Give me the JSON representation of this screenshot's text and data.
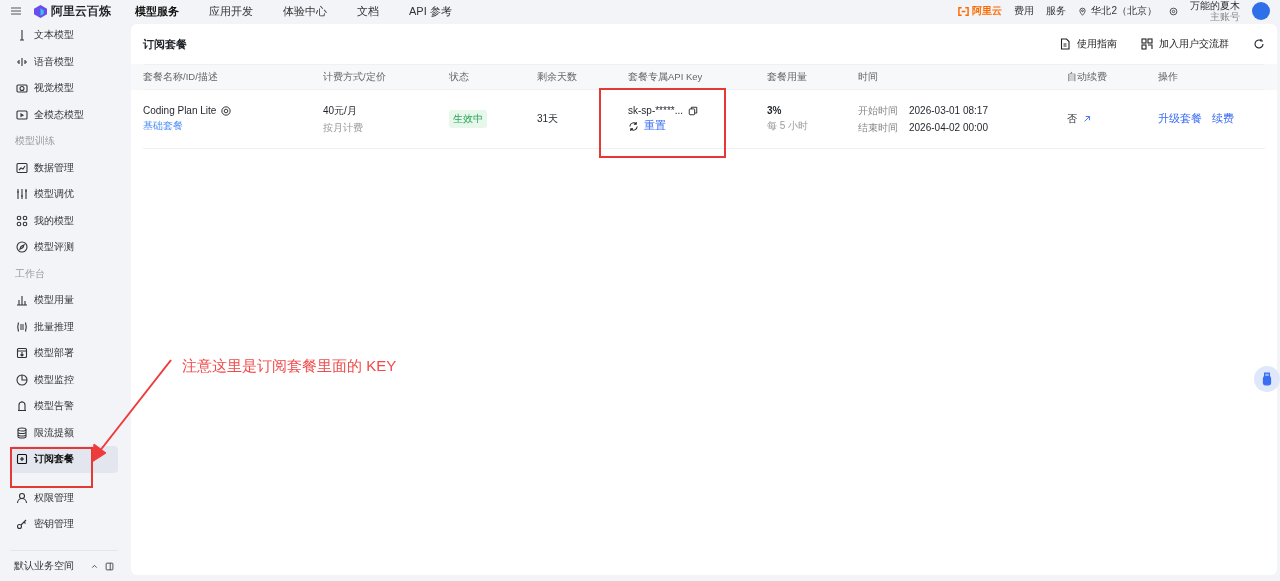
{
  "topbar": {
    "brand": "阿里云百炼",
    "nav": [
      {
        "label": "模型服务",
        "selected": true
      },
      {
        "label": "应用开发",
        "selected": false
      },
      {
        "label": "体验中心",
        "selected": false
      },
      {
        "label": "文档",
        "selected": false
      },
      {
        "label": "API 参考",
        "selected": false
      }
    ],
    "logo_text": "阿里云",
    "links": [
      "费用",
      "服务"
    ],
    "region": "华北2（北京）",
    "user": {
      "name": "万能的夏木",
      "role": "主账号"
    }
  },
  "sidebar": {
    "items": [
      {
        "kind": "item",
        "label": "文本模型",
        "selected": false
      },
      {
        "kind": "item",
        "label": "语音模型",
        "selected": false
      },
      {
        "kind": "item",
        "label": "视觉模型",
        "selected": false
      },
      {
        "kind": "item",
        "label": "全模态模型",
        "selected": false
      },
      {
        "kind": "section",
        "label": "模型训练"
      },
      {
        "kind": "item",
        "label": "数据管理",
        "selected": false
      },
      {
        "kind": "item",
        "label": "模型调优",
        "selected": false
      },
      {
        "kind": "item",
        "label": "我的模型",
        "selected": false
      },
      {
        "kind": "item",
        "label": "模型评测",
        "selected": false
      },
      {
        "kind": "section",
        "label": "工作台"
      },
      {
        "kind": "item",
        "label": "模型用量",
        "selected": false
      },
      {
        "kind": "item",
        "label": "批量推理",
        "selected": false
      },
      {
        "kind": "item",
        "label": "模型部署",
        "selected": false
      },
      {
        "kind": "item",
        "label": "模型监控",
        "selected": false
      },
      {
        "kind": "item",
        "label": "模型告警",
        "selected": false
      },
      {
        "kind": "item",
        "label": "限流提额",
        "selected": false
      },
      {
        "kind": "item",
        "label": "订阅套餐",
        "selected": true
      },
      {
        "kind": "gap"
      },
      {
        "kind": "item",
        "label": "权限管理",
        "selected": false
      },
      {
        "kind": "item",
        "label": "密钥管理",
        "selected": false
      }
    ],
    "workspace": "默认业务空间"
  },
  "main": {
    "title": "订阅套餐",
    "actions": [
      "使用指南",
      "加入用户交流群"
    ],
    "table": {
      "columns": [
        "套餐名称/ID/描述",
        "计费方式/定价",
        "状态",
        "剩余天数",
        "套餐专属API Key",
        "套餐用量",
        "时间",
        "自动续费",
        "操作"
      ],
      "rows": [
        {
          "name": "Coding Plan Lite",
          "tag": "基础套餐",
          "price": "40元/月",
          "billing": "按月计费",
          "status": "生效中",
          "days": "31天",
          "api_key": "sk-sp-*****...",
          "reset": "重置",
          "usage": "3%",
          "usage_period": "每 5 小时",
          "start_label": "开始时间",
          "start": "2026-03-01 08:17",
          "end_label": "结束时间",
          "end": "2026-04-02 00:00",
          "auto_renew": "否",
          "operations": [
            "升级套餐",
            "续费"
          ]
        }
      ]
    }
  },
  "annotation": {
    "text": "注意这里是订阅套餐里面的 KEY"
  }
}
